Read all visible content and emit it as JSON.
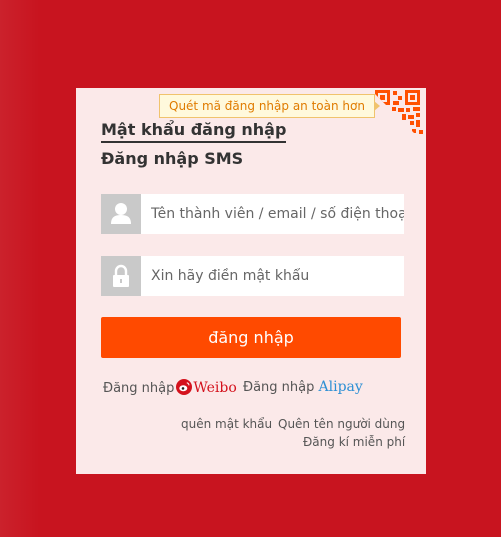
{
  "qr_tip": "Quét mã đăng nhập an toàn hơn",
  "tabs": {
    "password": "Mật khẩu đăng nhập",
    "sms": "Đăng nhập SMS"
  },
  "form": {
    "username_placeholder": "Tên thành viên / email / số điện thoại",
    "username_value": "",
    "password_placeholder": "Xin hãy điền mật khẩu",
    "password_value": ""
  },
  "login_button": "đăng nhập",
  "alt_login": {
    "weibo_prefix": "Đăng nhập",
    "weibo_brand": "Weibo",
    "alipay_prefix": "Đăng nhập",
    "alipay_brand": "Alipay"
  },
  "links": {
    "forgot_password": "quên mật khẩu",
    "forgot_username": "Quên tên người dùng",
    "register": "Đăng kí miễn phí"
  },
  "colors": {
    "page_bg": "#c8141f",
    "card_bg": "#fbe9e9",
    "button": "#ff4a00",
    "qr_orange": "#ff5000",
    "weibo_red": "#d4121d",
    "alipay_blue": "#2d8fd4"
  },
  "icons": {
    "user": "user-icon",
    "lock": "lock-icon",
    "qr": "qr-code-icon",
    "weibo": "weibo-icon"
  }
}
